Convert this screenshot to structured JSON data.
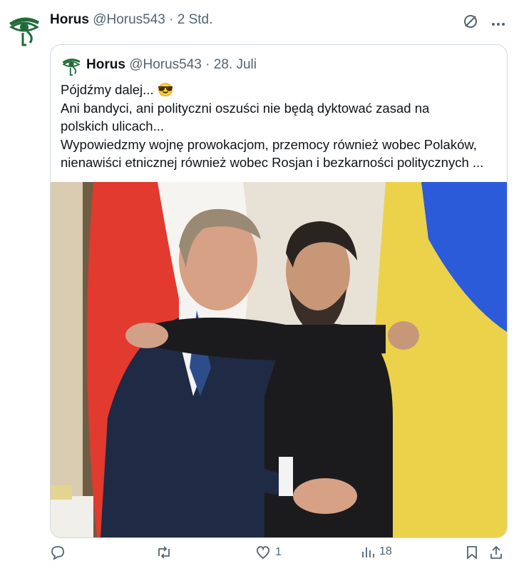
{
  "tweet": {
    "name": "Horus",
    "handle": "@Horus543",
    "separator": "·",
    "time": "2 Std."
  },
  "quote": {
    "name": "Horus",
    "handle": "@Horus543",
    "separator": "·",
    "date": "28. Juli",
    "lines": [
      "Pójdźmy dalej... 😎",
      "Ani bandyci, ani polityczni oszuści nie będą dyktować zasad na",
      "polskich ulicach...",
      "Wypowiedzmy wojnę prowokacjom, przemocy również wobec Polaków,",
      "nienawiści etnicznej również wobec Rosjan i bezkarności politycznych ..."
    ],
    "image_alt": "Two men in suits embracing in front of Polish and Ukrainian flags"
  },
  "actions": {
    "reply_count": "",
    "retweet_count": "",
    "like_count": "1",
    "views_count": "18"
  },
  "icons": [
    "eye-of-horus-avatar-icon",
    "grok-icon",
    "more-icon",
    "reply-icon",
    "retweet-icon",
    "like-icon",
    "views-icon",
    "bookmark-icon",
    "share-icon"
  ],
  "colors": {
    "avatar_green": "#1f6b3a",
    "text": "#0f1419",
    "meta": "#536471",
    "border": "#cfd9de"
  }
}
